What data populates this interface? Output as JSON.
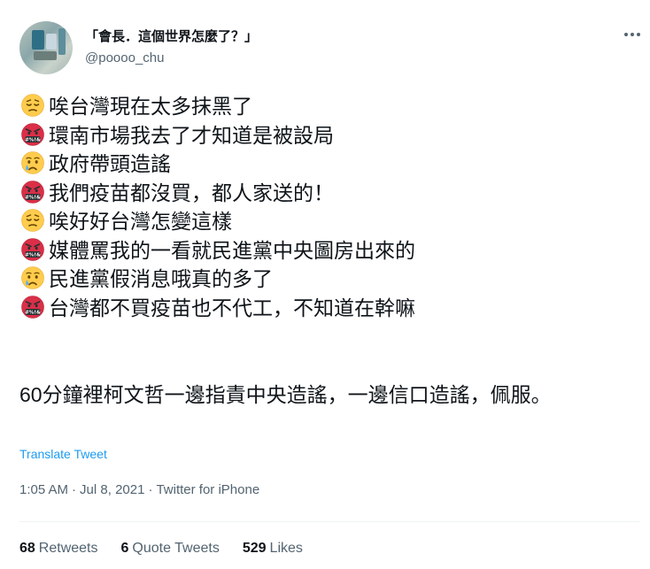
{
  "tweet": {
    "display_name": "「會長．這個世界怎麼了？」",
    "handle": "@poooo_chu",
    "lines": [
      {
        "emoji": "pensive-face",
        "text": "唉台灣現在太多抹黑了"
      },
      {
        "emoji": "face-with-symbols-on-mouth",
        "text": "環南市場我去了才知道是被設局"
      },
      {
        "emoji": "crying-face",
        "text": "政府帶頭造謠"
      },
      {
        "emoji": "face-with-symbols-on-mouth",
        "text": "我們疫苗都沒買，都人家送的！"
      },
      {
        "emoji": "pensive-face",
        "text": "唉好好台灣怎變這樣"
      },
      {
        "emoji": "face-with-symbols-on-mouth",
        "text": "媒體罵我的一看就民進黨中央圖房出來的"
      },
      {
        "emoji": "crying-face",
        "text": "民進黨假消息哦真的多了"
      },
      {
        "emoji": "face-with-symbols-on-mouth",
        "text": "台灣都不買疫苗也不代工，不知道在幹嘛"
      }
    ],
    "paragraph": "60分鐘裡柯文哲一邊指責中央造謠，一邊信口造謠，佩服。",
    "translate_label": "Translate Tweet",
    "time": "1:05 AM",
    "date": "Jul 8, 2021",
    "source": "Twitter for iPhone",
    "separator": "·",
    "retweets_count": "68",
    "retweets_label": "Retweets",
    "quote_count": "6",
    "quote_label": "Quote Tweets",
    "likes_count": "529",
    "likes_label": "Likes"
  },
  "colors": {
    "text": "#0f1419",
    "secondary": "#536471",
    "link": "#1d9bf0",
    "divider": "#eff3f4"
  }
}
